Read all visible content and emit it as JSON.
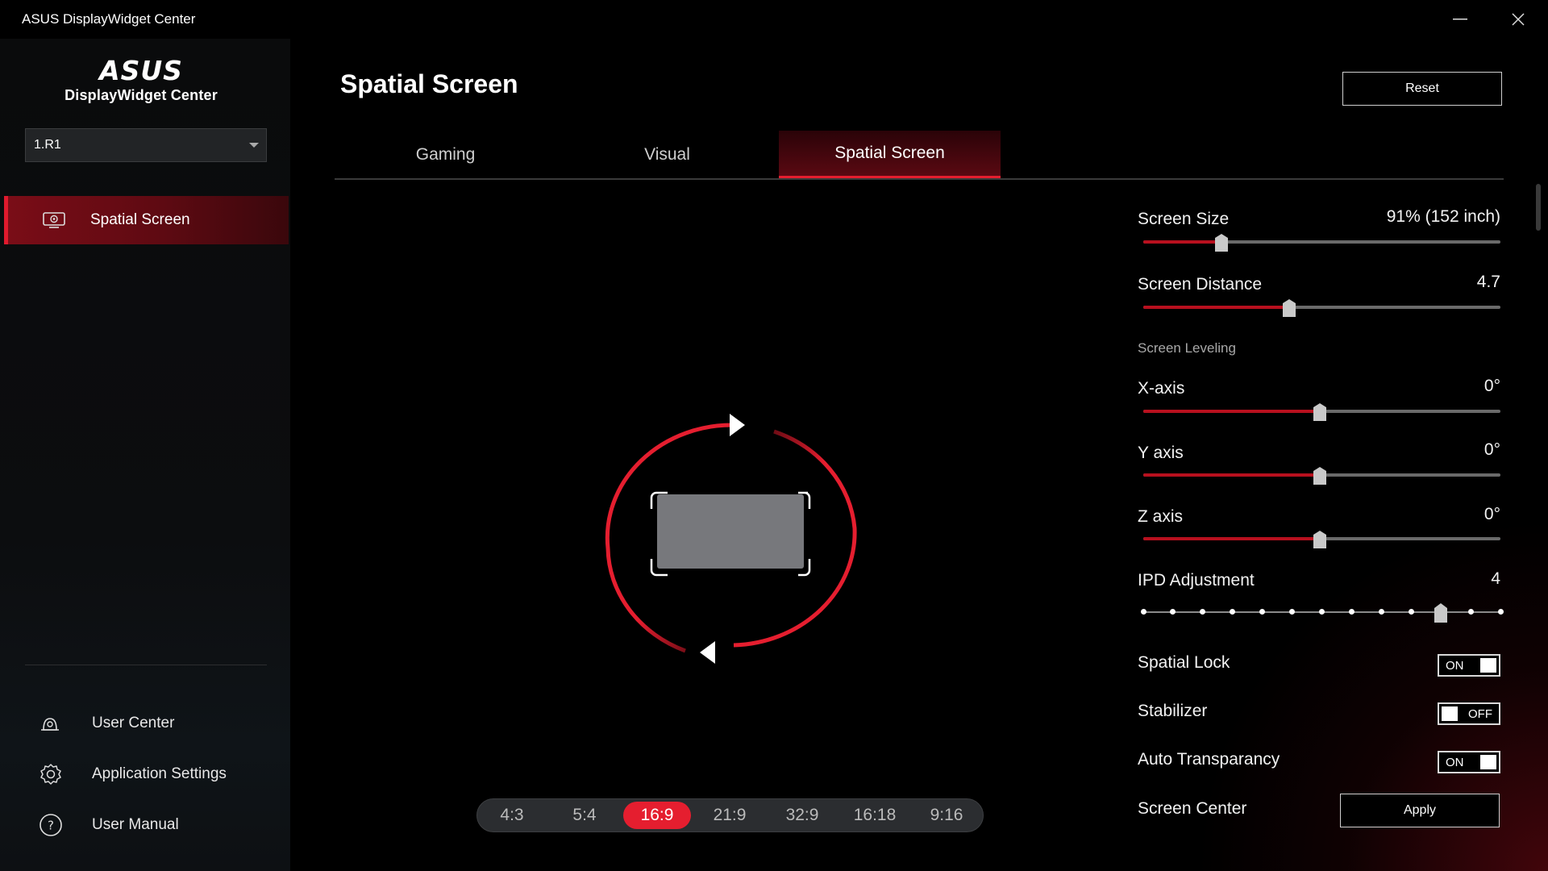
{
  "window": {
    "title": "ASUS DisplayWidget Center"
  },
  "brand": {
    "logo_text": "ASUS",
    "name": "DisplayWidget Center"
  },
  "device_select": {
    "value": "1.R1"
  },
  "sidebar": {
    "active_item": {
      "label": "Spatial Screen",
      "icon": "monitor-icon"
    },
    "bottom_links": [
      {
        "label": "User Center",
        "icon": "user-center-icon"
      },
      {
        "label": "Application Settings",
        "icon": "gear-icon"
      },
      {
        "label": "User Manual",
        "icon": "help-icon"
      }
    ]
  },
  "header": {
    "title": "Spatial Screen",
    "reset_label": "Reset"
  },
  "tabs": [
    {
      "label": "Gaming",
      "active": false
    },
    {
      "label": "Visual",
      "active": false
    },
    {
      "label": "Spatial Screen",
      "active": true
    }
  ],
  "aspect_ratios": {
    "options": [
      "4:3",
      "5:4",
      "16:9",
      "21:9",
      "32:9",
      "16:18",
      "9:16"
    ],
    "selected": "16:9"
  },
  "controls": {
    "screen_size": {
      "label": "Screen Size",
      "value": "91%  (152 inch)",
      "level": 0.22
    },
    "screen_distance": {
      "label": "Screen Distance",
      "value": "4.7",
      "level": 0.408
    },
    "screen_leveling": {
      "label": "Screen Leveling"
    },
    "x_axis": {
      "label": "X-axis",
      "value": "0°",
      "level": 0.495
    },
    "y_axis": {
      "label": "Y axis",
      "value": "0°",
      "level": 0.495
    },
    "z_axis": {
      "label": "Z axis",
      "value": "0°",
      "level": 0.495
    },
    "ipd": {
      "label": "IPD Adjustment",
      "value": "4",
      "steps": 13,
      "selected_step": 10
    },
    "spatial_lock": {
      "label": "Spatial Lock",
      "state": "ON"
    },
    "stabilizer": {
      "label": "Stabilizer",
      "state": "OFF"
    },
    "auto_transparency": {
      "label": "Auto Transparancy",
      "state": "ON"
    },
    "screen_center": {
      "label": "Screen Center",
      "button_label": "Apply"
    }
  },
  "colors": {
    "accent": "#e51e2f",
    "accent_dark": "#7a0d17",
    "background": "#000000"
  }
}
